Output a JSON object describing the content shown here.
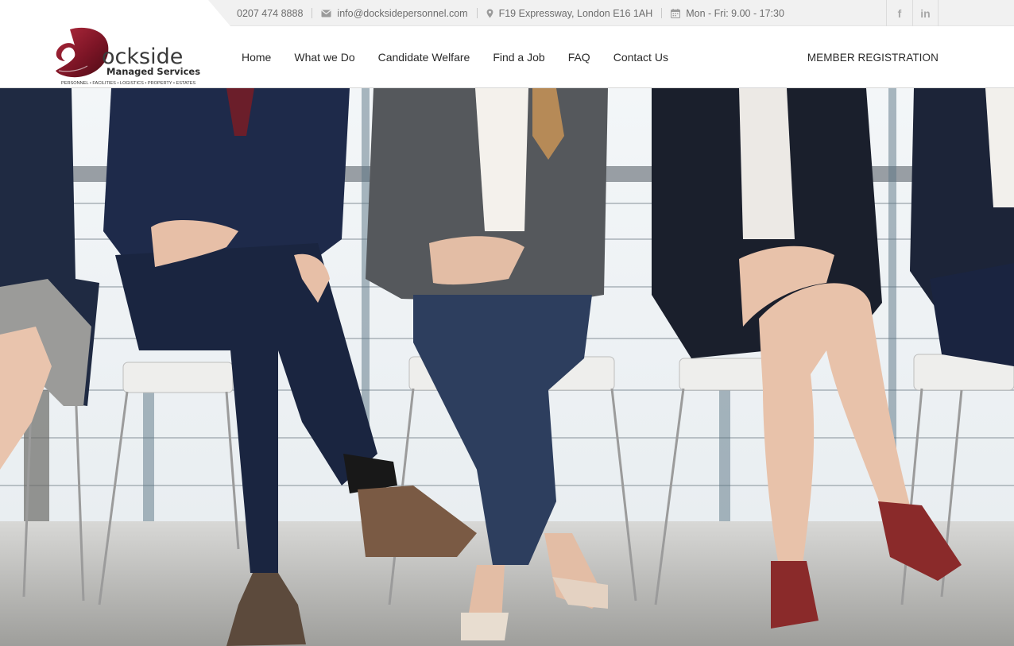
{
  "topbar": {
    "phone": "0207 474 8888",
    "email": "info@dockside­personnel.com",
    "address": "F19 Expressway, London E16 1AH",
    "hours": "Mon - Fri: 9.00 - 17:30",
    "icons": {
      "email": "envelope-icon",
      "address": "map-pin-icon",
      "hours": "calendar-icon"
    },
    "social": [
      {
        "label": "f",
        "icon": "facebook-icon"
      },
      {
        "label": "in",
        "icon": "linkedin-icon"
      }
    ]
  },
  "logo": {
    "initial": "D",
    "wordmark": "ockside",
    "subtitle": "Managed Services",
    "tagline": "PERSONNEL • FACILITIES • LOGISTICS • PROPERTY • ESTATES",
    "brand_color": "#8b1a2b"
  },
  "nav": {
    "items": [
      "Home",
      "What we Do",
      "Candidate Welfare",
      "Find a Job",
      "FAQ",
      "Contact Us"
    ],
    "member_registration": "MEMBER REGISTRATION"
  },
  "hero": {
    "image": "people-seated-in-row-photo"
  }
}
